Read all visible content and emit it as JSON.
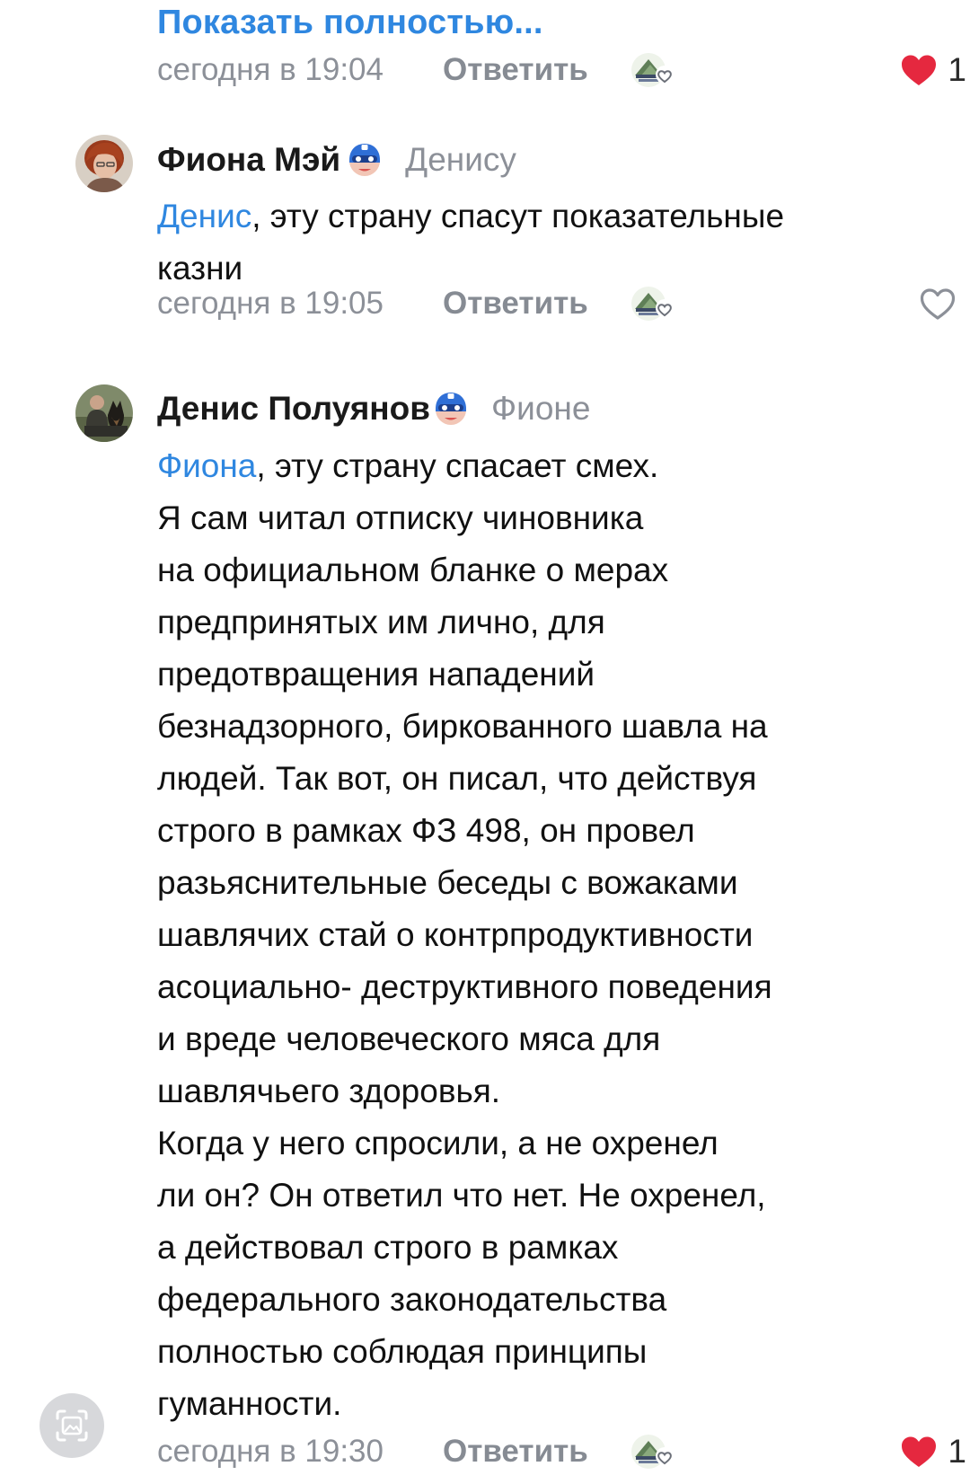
{
  "prev_comment": {
    "show_more_label": "Показать полностью...",
    "timestamp": "сегодня в 19:04",
    "reply_label": "Ответить",
    "likes": "1",
    "liked": true
  },
  "comments": [
    {
      "author": "Фиона Мэй",
      "reply_to": "Денису",
      "mention": "Денис",
      "text": ", эту страну спасут показательные\nказни",
      "timestamp": "сегодня в 19:05",
      "reply_label": "Ответить",
      "likes": "",
      "liked": false
    },
    {
      "author": "Денис Полуянов",
      "reply_to": "Фионе",
      "mention": "Фиона",
      "text": ", эту страну спасает смех.\nЯ сам читал отписку чиновника\nна официальном бланке о мерах\nпредпринятых им лично, для\nпредотвращения нападений\nбезнадзорного, биркованного шавла на\nлюдей. Так вот, он писал, что действуя\nстрого в рамках ФЗ 498, он провел\nразьяснительные беседы с вожаками\nшавлячих стай о контрпродуктивности\nасоциально- деструктивного поведения\nи вреде человеческого мяса для\nшавлячьего здоровья.\nКогда у него спросили, а не охренел\nли он? Он ответил что нет. Не охренел,\nа действовал строго в рамках\nфедерального законодательства\nполностью соблюдая принципы\nгуманности.",
      "timestamp": "сегодня в 19:30",
      "reply_label": "Ответить",
      "likes": "1",
      "liked": true
    }
  ],
  "colors": {
    "link": "#2f87e0",
    "meta": "#8c9098",
    "like_red": "#e5283f"
  },
  "icons": {
    "reaction": "add-reaction-icon",
    "like": "heart-icon",
    "badge": "hero-mask-icon",
    "scan": "screenshot-scan-icon"
  }
}
